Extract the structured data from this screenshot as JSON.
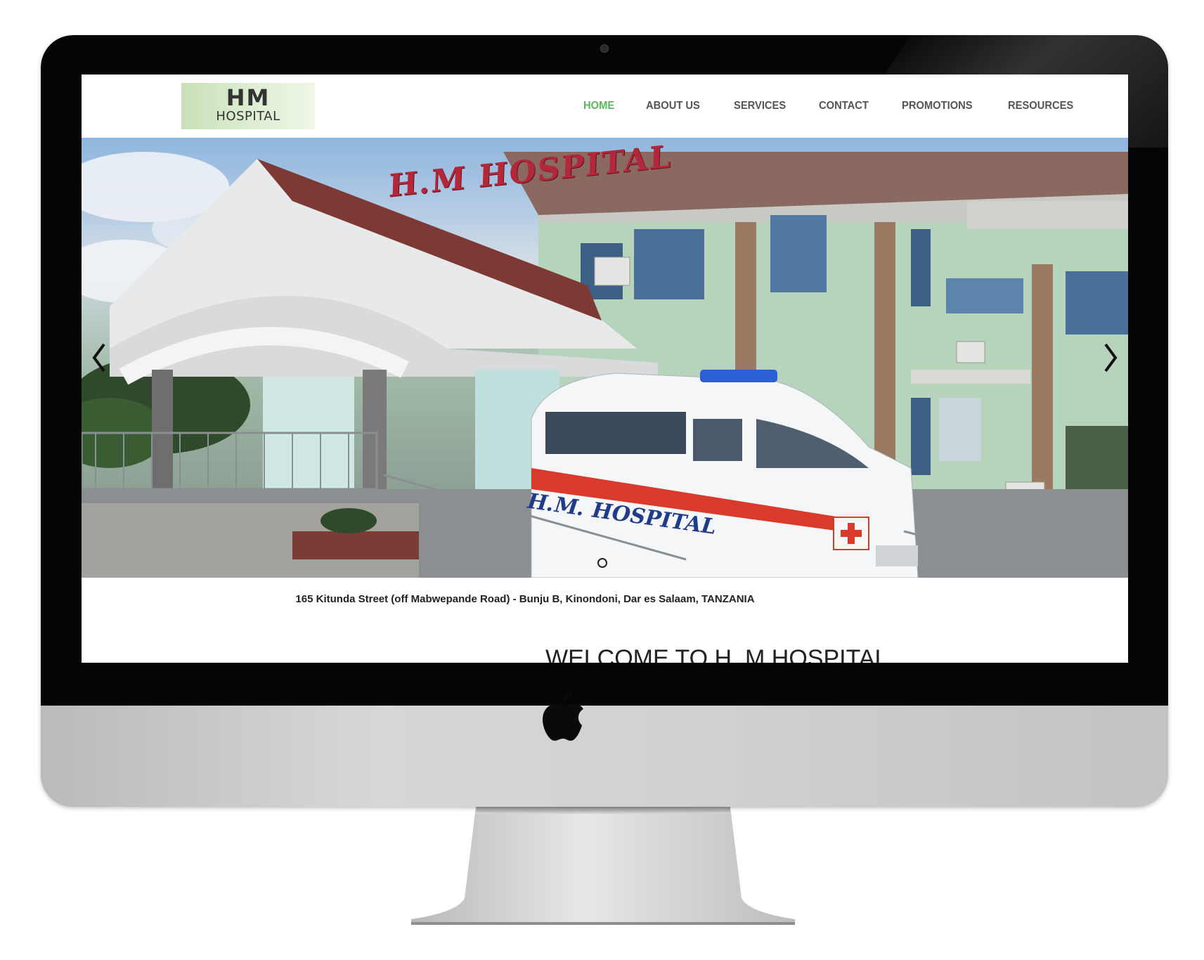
{
  "header": {
    "logo_mark": "HM",
    "logo_text": "HOSPITAL"
  },
  "nav": {
    "items": [
      {
        "label": "HOME",
        "active": true
      },
      {
        "label": "ABOUT US",
        "active": false
      },
      {
        "label": "SERVICES",
        "active": false
      },
      {
        "label": "CONTACT",
        "active": false
      },
      {
        "label": "PROMOTIONS",
        "active": false
      },
      {
        "label": "RESOURCES",
        "active": false
      }
    ],
    "active_color": "#5cb85c"
  },
  "hero": {
    "sign_text": "H.M HOSPITAL",
    "ambulance_text": "H.M. HOSPITAL",
    "prev_icon": "chevron-left-icon",
    "next_icon": "chevron-right-icon"
  },
  "address": "165 Kitunda Street (off Mabwepande Road) - Bunju B, Kinondoni, Dar es Salaam, TANZANIA",
  "welcome_title": "WELCOME TO H. M HOSPITAL"
}
